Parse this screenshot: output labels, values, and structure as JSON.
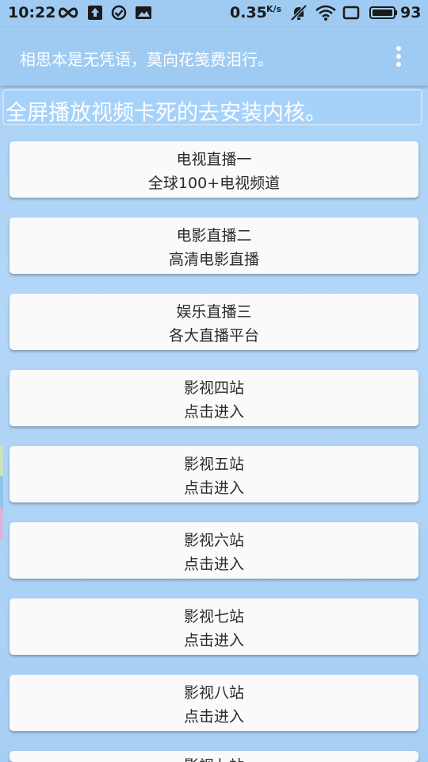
{
  "status_bar": {
    "time": "10:22",
    "network_speed": "0.35",
    "speed_unit": "K/s",
    "battery": "93",
    "icons": [
      "infinity-icon",
      "upload-icon",
      "check-circle-icon",
      "image-icon",
      "mute-bell-icon",
      "wifi-icon",
      "screen-rotate-icon",
      "battery-icon"
    ]
  },
  "app_bar": {
    "title": "相思本是无凭语，莫向花笺费泪行。",
    "menu_icon": "more-vert-icon"
  },
  "notice": {
    "text": "全屏播放视频卡死的去安装内核。"
  },
  "colors": {
    "bar": "#9fcbf3",
    "background": "#a9d1f6",
    "card": "#fafafa"
  },
  "items": [
    {
      "title": "电视直播一",
      "subtitle": "全球100+电视频道"
    },
    {
      "title": "电影直播二",
      "subtitle": "高清电影直播"
    },
    {
      "title": "娱乐直播三",
      "subtitle": "各大直播平台"
    },
    {
      "title": "影视四站",
      "subtitle": "点击进入"
    },
    {
      "title": "影视五站",
      "subtitle": "点击进入"
    },
    {
      "title": "影视六站",
      "subtitle": "点击进入"
    },
    {
      "title": "影视七站",
      "subtitle": "点击进入"
    },
    {
      "title": "影视八站",
      "subtitle": "点击进入"
    },
    {
      "title": "影视九站",
      "subtitle": ""
    }
  ]
}
